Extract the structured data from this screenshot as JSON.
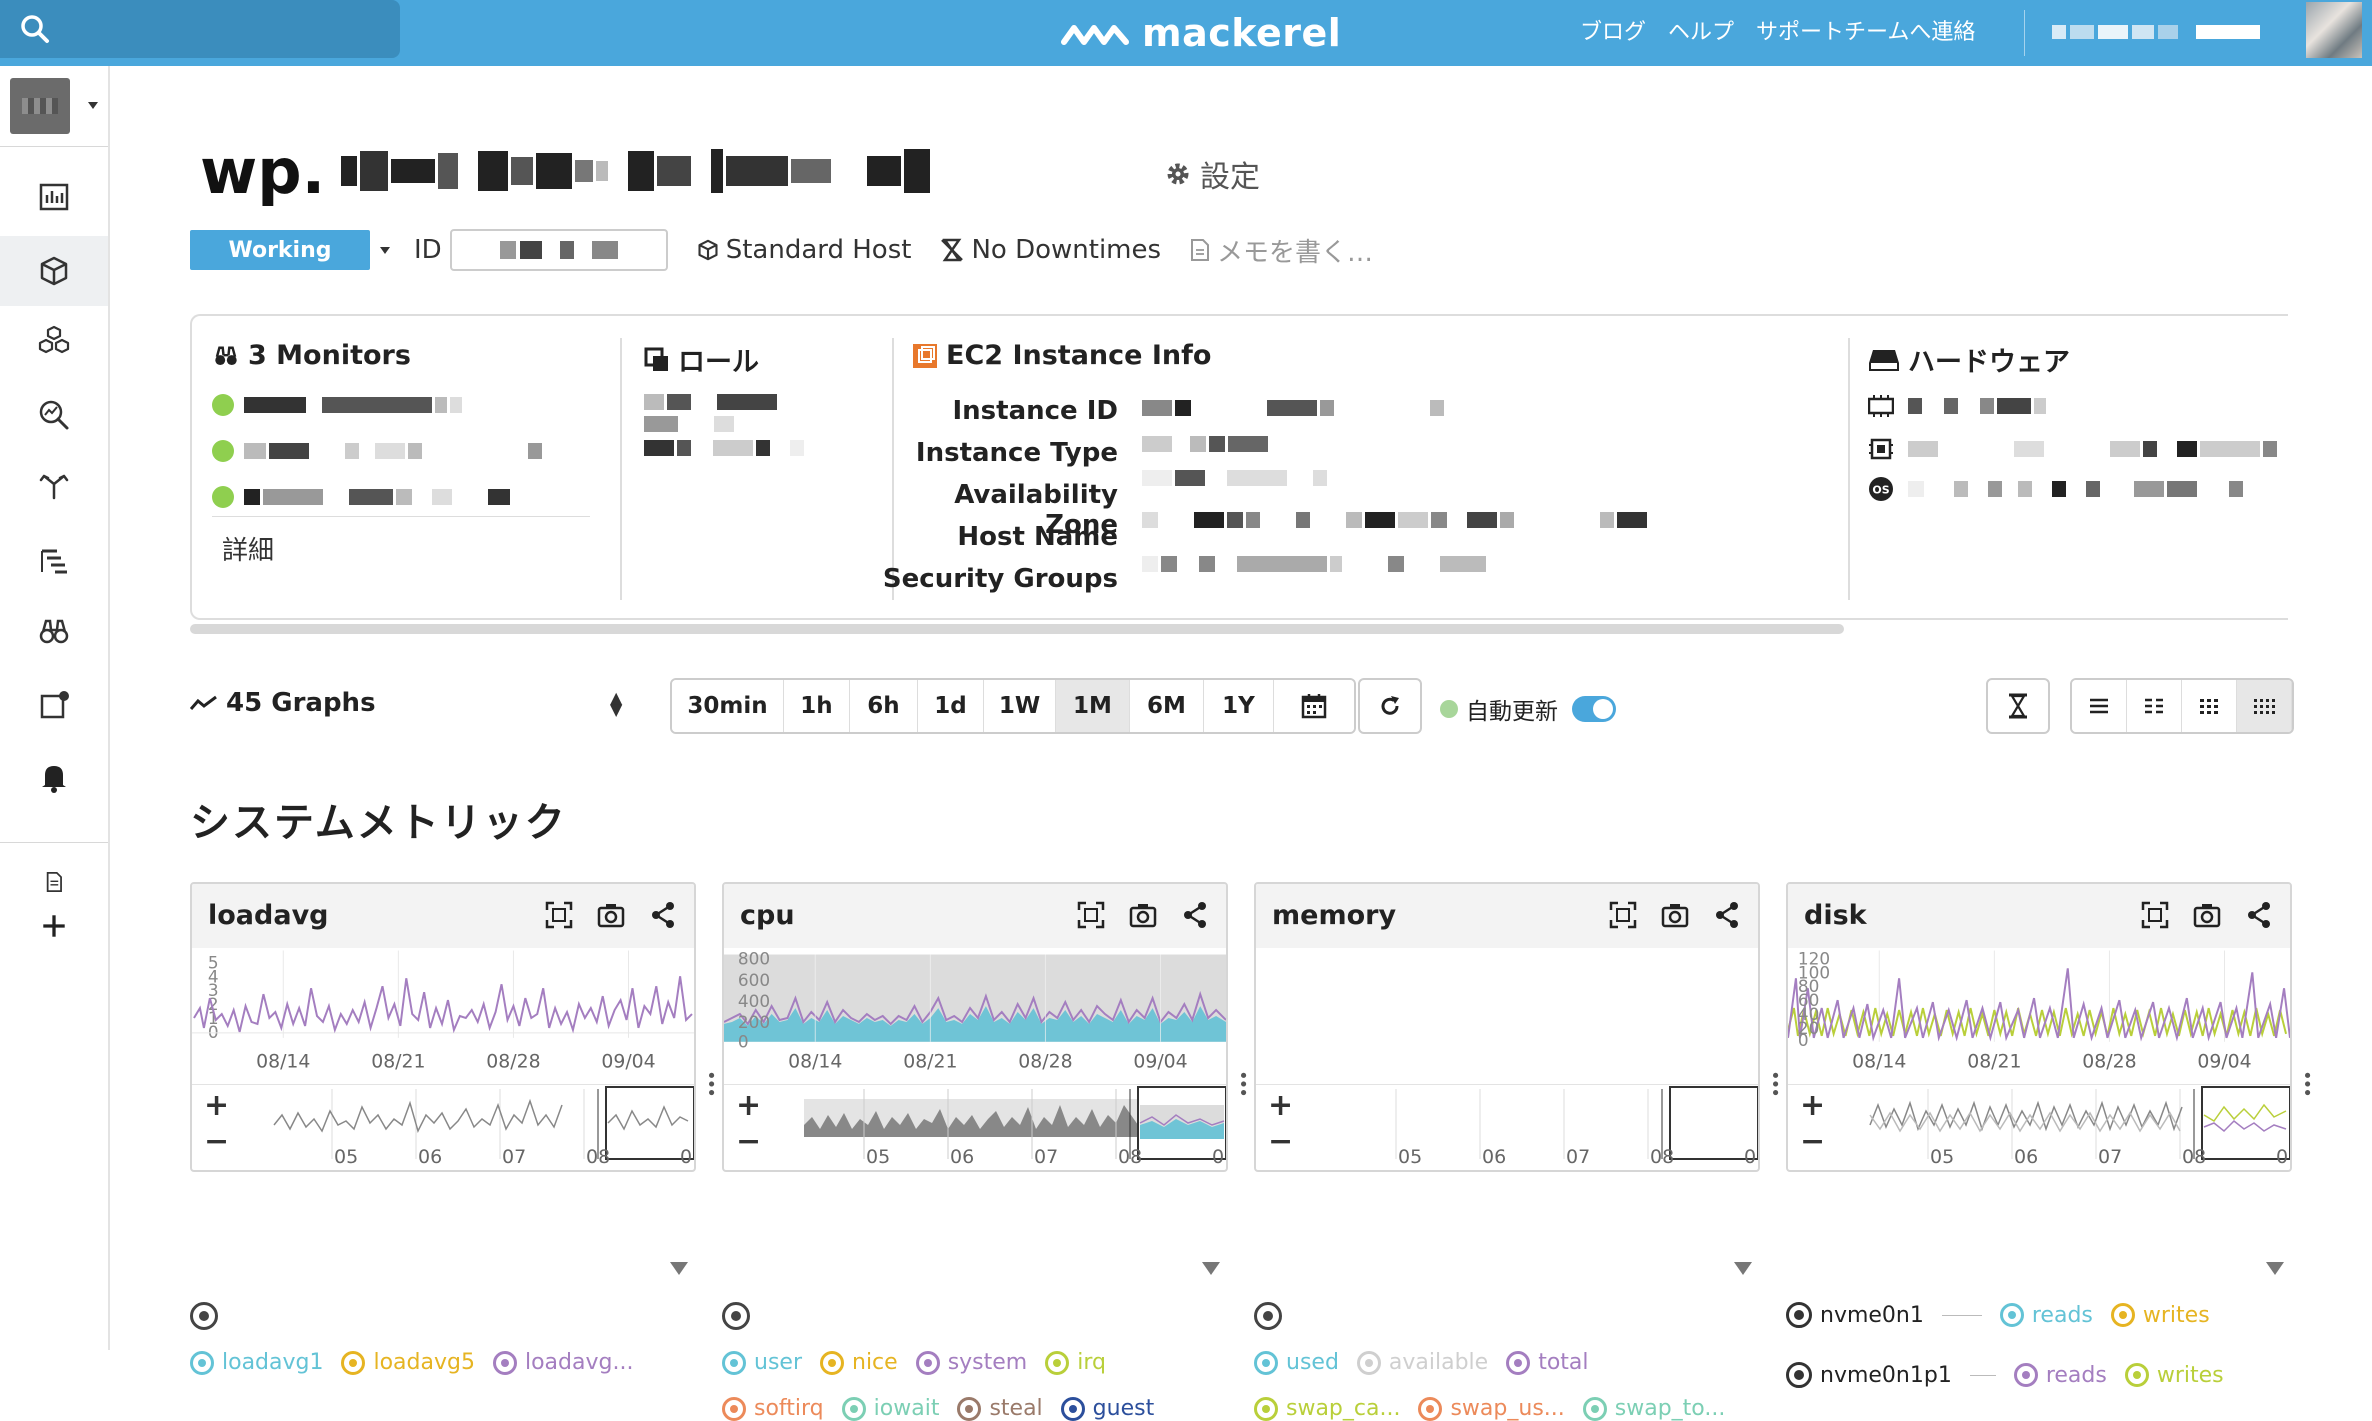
{
  "topbar": {
    "search_placeholder": "",
    "logo_text": "mackerel",
    "links": [
      "ブログ",
      "ヘルプ",
      "サポートチームへ連絡"
    ]
  },
  "sidebar": {
    "items": [
      "dashboard-icon",
      "hosts-icon",
      "services-icon",
      "search-analysis-icon",
      "roles-icon",
      "trace-icon",
      "monitors-icon",
      "alerts-icon",
      "notifications-icon",
      "docs-icon",
      "add-icon"
    ]
  },
  "host": {
    "name_prefix": "wp.",
    "settings_label": "設定",
    "status": "Working",
    "id_label": "ID",
    "host_type": "Standard Host",
    "downtime": "No Downtimes",
    "memo_placeholder": "メモを書く…"
  },
  "info": {
    "monitors_title": "3 Monitors",
    "detail_link": "詳細",
    "roles_title": "ロール",
    "ec2_title": "EC2 Instance Info",
    "ec2_keys": [
      "Instance ID",
      "Instance Type",
      "Availability Zone",
      "Host Name",
      "Security Groups"
    ],
    "hardware_title": "ハードウェア"
  },
  "toolbar": {
    "graphs_count": "45 Graphs",
    "ranges": [
      "30min",
      "1h",
      "6h",
      "1d",
      "1W",
      "1M",
      "6M",
      "1Y"
    ],
    "selected_range": "1M",
    "auto_update_label": "自動更新",
    "auto_update_on": true
  },
  "section": {
    "title": "システムメトリック"
  },
  "graphs": [
    {
      "title": "loadavg",
      "y_ticks": [
        "5",
        "4",
        "3",
        "2",
        "1",
        "0"
      ],
      "x_ticks": [
        "08/14",
        "08/21",
        "08/28",
        "09/04"
      ],
      "nav_ticks": [
        "05",
        "06",
        "07",
        "08",
        "0"
      ],
      "legend": [
        {
          "label": "loadavg1",
          "color": "#63c3d6"
        },
        {
          "label": "loadavg5",
          "color": "#e6b422"
        },
        {
          "label": "loadavg...",
          "color": "#a47ec0"
        }
      ]
    },
    {
      "title": "cpu",
      "y_ticks": [
        "800",
        "600",
        "400",
        "200",
        "0"
      ],
      "x_ticks": [
        "08/14",
        "08/21",
        "08/28",
        "09/04"
      ],
      "nav_ticks": [
        "05",
        "06",
        "07",
        "08",
        "0"
      ],
      "legend": [
        {
          "label": "user",
          "color": "#63c3d6"
        },
        {
          "label": "nice",
          "color": "#e6b422"
        },
        {
          "label": "system",
          "color": "#a47ec0"
        },
        {
          "label": "irq",
          "color": "#b9cf3a"
        },
        {
          "label": "softirq",
          "color": "#ec8a5a"
        },
        {
          "label": "iowait",
          "color": "#7ccfb4"
        },
        {
          "label": "steal",
          "color": "#9a7a6a"
        },
        {
          "label": "guest",
          "color": "#2c4f9c"
        }
      ]
    },
    {
      "title": "memory",
      "y_ticks": [],
      "x_ticks": [],
      "nav_ticks": [
        "05",
        "06",
        "07",
        "08",
        "0"
      ],
      "legend": [
        {
          "label": "used",
          "color": "#63c3d6"
        },
        {
          "label": "available",
          "color": "#cfcfcf"
        },
        {
          "label": "total",
          "color": "#a47ec0"
        },
        {
          "label": "swap_ca...",
          "color": "#b9cf3a"
        },
        {
          "label": "swap_us...",
          "color": "#ec8a5a"
        },
        {
          "label": "swap_to...",
          "color": "#7ccfb4"
        }
      ]
    },
    {
      "title": "disk",
      "y_ticks": [
        "120",
        "100",
        "80",
        "60",
        "40",
        "20",
        "0"
      ],
      "x_ticks": [
        "08/14",
        "08/21",
        "08/28",
        "09/04"
      ],
      "nav_ticks": [
        "05",
        "06",
        "07",
        "08",
        "0"
      ],
      "devices": [
        {
          "name": "nvme0n1",
          "reads": "reads",
          "writes": "writes"
        },
        {
          "name": "nvme0n1p1",
          "reads": "reads",
          "writes": "writes"
        }
      ],
      "reads_color": "#63c3d6",
      "writes_color": "#b9cf3a",
      "reads2_color": "#a47ec0"
    }
  ]
}
